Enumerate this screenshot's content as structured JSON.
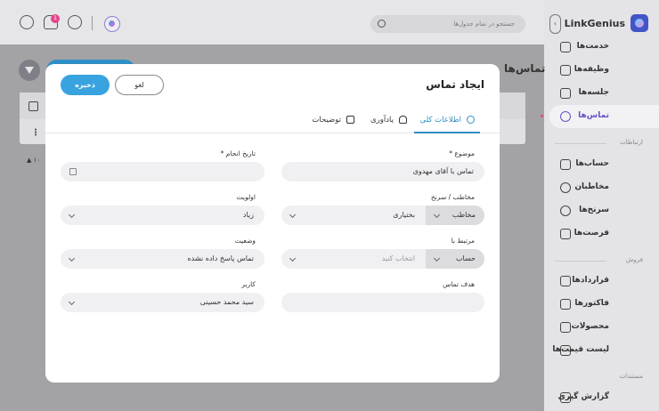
{
  "header": {
    "search_placeholder": "جستجو در تمام جدول‌ها",
    "notification_count": "1"
  },
  "sidebar": {
    "brand": "LinkGenius",
    "items_top": [
      {
        "label": "خدمت‌ها",
        "icon": "services-icon"
      },
      {
        "label": "وظیفه‌ها",
        "icon": "tasks-icon"
      },
      {
        "label": "جلسه‌ها",
        "icon": "meetings-icon"
      },
      {
        "label": "تماس‌ها",
        "icon": "calls-icon",
        "active": true
      }
    ],
    "section_relations": "ارتباطات",
    "items_relations": [
      {
        "label": "حساب‌ها",
        "icon": "accounts-icon"
      },
      {
        "label": "مخاطبان",
        "icon": "contacts-icon"
      },
      {
        "label": "سرنخ‌ها",
        "icon": "leads-icon"
      },
      {
        "label": "فرصت‌ها",
        "icon": "opportunities-icon"
      }
    ],
    "section_sales": "فروش",
    "items_sales": [
      {
        "label": "قراردادها",
        "icon": "contracts-icon"
      },
      {
        "label": "فاکتورها",
        "icon": "invoices-icon"
      },
      {
        "label": "محصولات",
        "icon": "products-icon"
      },
      {
        "label": "لیست قیمت‌ها",
        "icon": "pricelists-icon"
      }
    ],
    "section_docs": "مستندات",
    "items_docs": [
      {
        "label": "گزارش گیری",
        "icon": "reports-icon"
      }
    ]
  },
  "background": {
    "page_title": "تماس‌ها",
    "pager": "۱۰"
  },
  "modal": {
    "title": "ایجاد تماس",
    "save_label": "ذخیره",
    "cancel_label": "لغو",
    "tabs": [
      {
        "label": "اطلاعات کلی",
        "icon": "info-icon",
        "active": true
      },
      {
        "label": "یادآوری",
        "icon": "bell-icon"
      },
      {
        "label": "توضیحات",
        "icon": "document-icon"
      }
    ],
    "fields": {
      "subject": {
        "label": "موضوع *",
        "value": "تماس با آقای مهدوی"
      },
      "date": {
        "label": "تاریخ انجام *",
        "value": ""
      },
      "contact": {
        "label": "مخاطب / سرنخ",
        "type_value": "مخاطب",
        "value": "بختیاری"
      },
      "priority": {
        "label": "اولویت",
        "value": "زیاد"
      },
      "related": {
        "label": "مرتبط با",
        "type_value": "حساب",
        "placeholder": "انتخاب کنید"
      },
      "status": {
        "label": "وضعیت",
        "value": "تماس پاسخ داده نشده"
      },
      "goal": {
        "label": "هدف تماس",
        "value": ""
      },
      "user": {
        "label": "کاربر",
        "value": "سید محمد حسینی"
      }
    }
  },
  "colors": {
    "primary": "#39a3e0",
    "accent": "#6750c8",
    "badge": "#e8458b"
  }
}
